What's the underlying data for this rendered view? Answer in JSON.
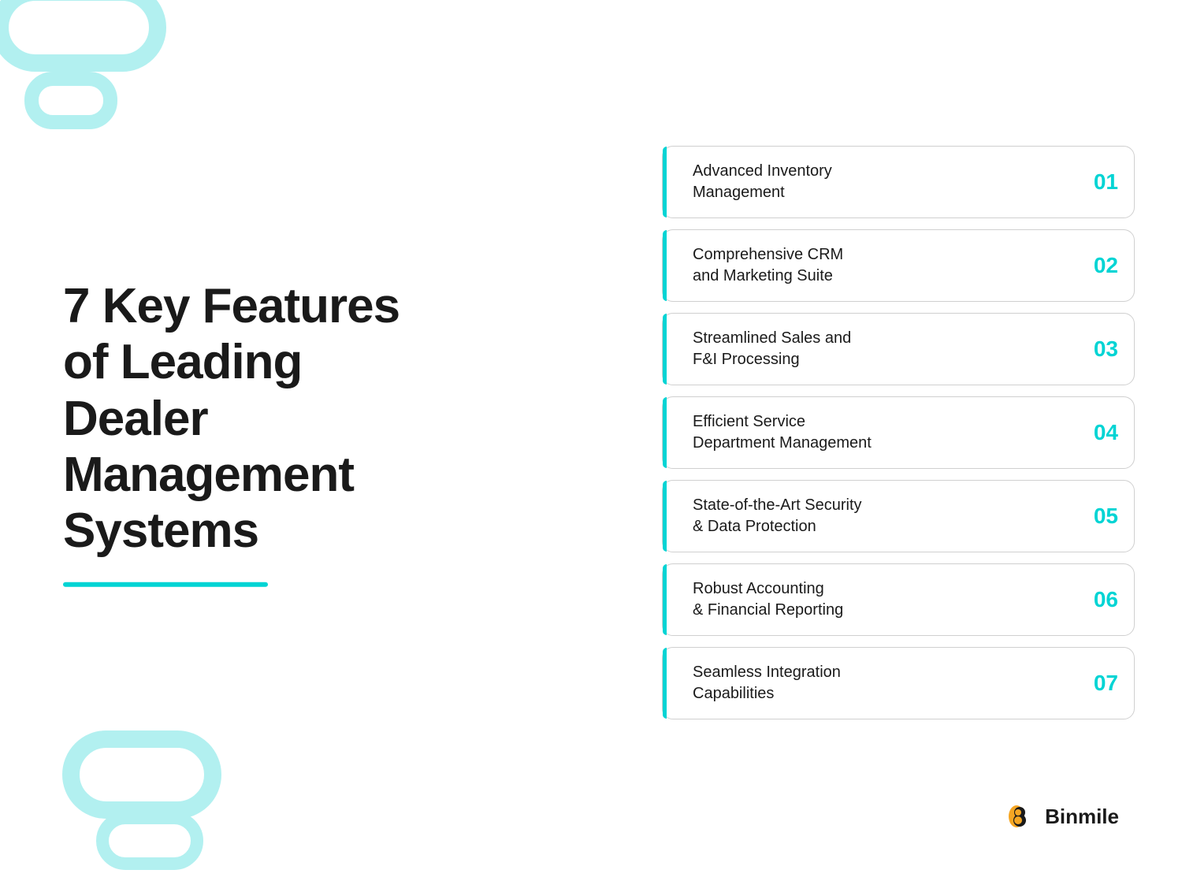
{
  "decorations": {
    "top_left_color": "#b2f0f0",
    "bottom_left_color": "#b2f0f0"
  },
  "left": {
    "title_line1": "7 Key Features",
    "title_line2": "of Leading Dealer",
    "title_line3": "Management Systems",
    "underline_color": "#00d4d4"
  },
  "features": [
    {
      "number": "01",
      "label": "Advanced Inventory\nManagement"
    },
    {
      "number": "02",
      "label": "Comprehensive CRM\nand Marketing Suite"
    },
    {
      "number": "03",
      "label": "Streamlined Sales and\nF&I Processing"
    },
    {
      "number": "04",
      "label": "Efficient Service\nDepartment Management"
    },
    {
      "number": "05",
      "label": "State-of-the-Art Security\n& Data Protection"
    },
    {
      "number": "06",
      "label": "Robust Accounting\n& Financial Reporting"
    },
    {
      "number": "07",
      "label": "Seamless Integration\nCapabilities"
    }
  ],
  "logo": {
    "text": "Binmile"
  }
}
